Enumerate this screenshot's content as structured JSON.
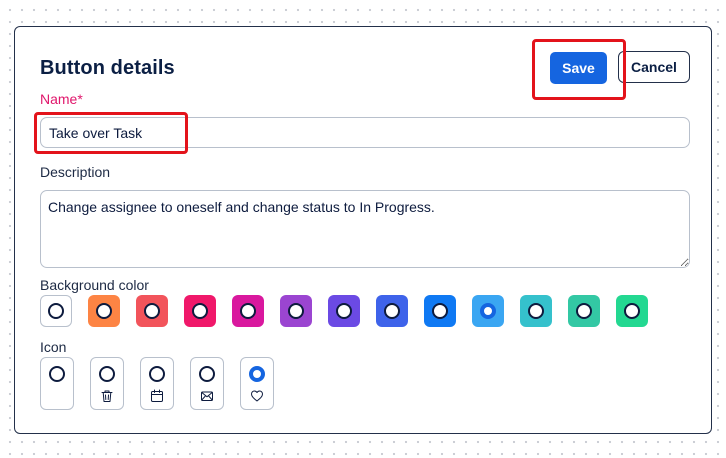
{
  "dialog": {
    "title": "Button details",
    "save_label": "Save",
    "cancel_label": "Cancel"
  },
  "name": {
    "label": "Name*",
    "value": "Take over Task"
  },
  "description": {
    "label": "Description",
    "value": "Change assignee to oneself and change status to In Progress."
  },
  "background_color": {
    "label": "Background color",
    "options": [
      {
        "name": "white",
        "color": "#ffffff",
        "selected": false
      },
      {
        "name": "orange",
        "color": "#fd8444",
        "selected": false
      },
      {
        "name": "coral",
        "color": "#f2545b",
        "selected": false
      },
      {
        "name": "rose",
        "color": "#f0186a",
        "selected": false
      },
      {
        "name": "magenta",
        "color": "#d9189e",
        "selected": false
      },
      {
        "name": "purple",
        "color": "#9b45d1",
        "selected": false
      },
      {
        "name": "violet",
        "color": "#6b4ae4",
        "selected": false
      },
      {
        "name": "indigo",
        "color": "#3e63ea",
        "selected": false
      },
      {
        "name": "blue",
        "color": "#0f79f3",
        "selected": false
      },
      {
        "name": "sky",
        "color": "#3aa6f2",
        "selected": true
      },
      {
        "name": "teal",
        "color": "#35c1cc",
        "selected": false
      },
      {
        "name": "green-teal",
        "color": "#33c8a4",
        "selected": false
      },
      {
        "name": "green",
        "color": "#23d891",
        "selected": false
      }
    ]
  },
  "icon": {
    "label": "Icon",
    "options": [
      {
        "name": "none",
        "icon": "none-icon",
        "selected": false
      },
      {
        "name": "trash",
        "icon": "trash-icon",
        "selected": false
      },
      {
        "name": "calendar",
        "icon": "calendar-icon",
        "selected": false
      },
      {
        "name": "mail",
        "icon": "mail-icon",
        "selected": false
      },
      {
        "name": "heart",
        "icon": "heart-icon",
        "selected": true
      }
    ]
  },
  "colors": {
    "accent": "#1565e0",
    "annotation": "#e3131b",
    "required": "#e0166b"
  }
}
